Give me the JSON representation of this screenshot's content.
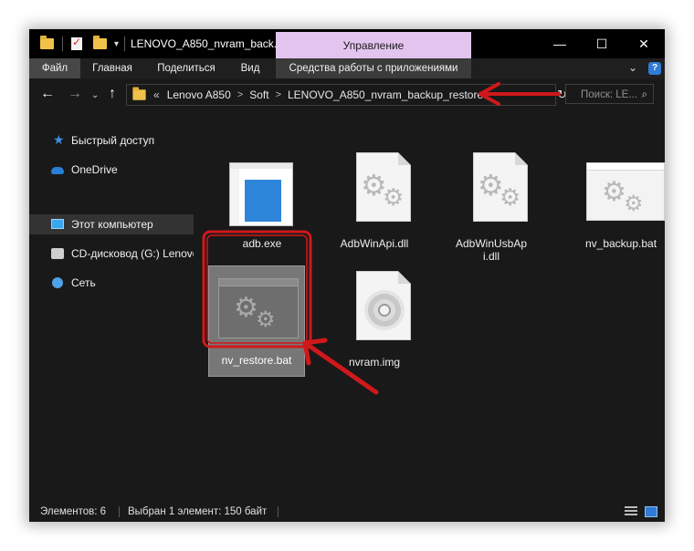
{
  "window": {
    "title": "LENOVO_A850_nvram_back...",
    "context_tab": "Управление",
    "controls": {
      "minimize": "—",
      "maximize": "☐",
      "close": "✕"
    }
  },
  "ribbon": {
    "tabs": [
      "Файл",
      "Главная",
      "Поделиться",
      "Вид",
      "Средства работы с приложениями"
    ],
    "help": "?",
    "collapse": "⌄"
  },
  "nav": {
    "back": "←",
    "forward": "→",
    "recent": "⌄",
    "up": "↑",
    "overflow": "«",
    "breadcrumb": [
      "Lenovo A850",
      "Soft",
      "LENOVO_A850_nvram_backup_restore"
    ],
    "crumb_separator": ">",
    "address_dropdown": "⌄",
    "refresh": "↻",
    "search_placeholder": "Поиск: LE...",
    "search_icon": "⌕"
  },
  "sidebar": {
    "items": [
      {
        "label": "Быстрый доступ",
        "icon": "star-icon",
        "glyph": "★"
      },
      {
        "label": "OneDrive",
        "icon": "cloud-icon",
        "glyph": ""
      },
      {
        "label": "Этот компьютер",
        "icon": "computer-icon",
        "glyph": "",
        "selected": true
      },
      {
        "label": "CD-дисковод (G:) Lenovo",
        "icon": "cd-drive-icon",
        "glyph": ""
      },
      {
        "label": "Сеть",
        "icon": "network-icon",
        "glyph": ""
      }
    ]
  },
  "files": [
    {
      "name": "adb.exe",
      "icon": "exe-icon"
    },
    {
      "name": "AdbWinApi.dll",
      "icon": "dll-gear-icon"
    },
    {
      "name": "AdbWinUsbApi.dll",
      "icon": "dll-gear-icon"
    },
    {
      "name": "nv_backup.bat",
      "icon": "bat-gear-icon"
    },
    {
      "name": "nv_restore.bat",
      "icon": "bat-gear-icon",
      "selected": true
    },
    {
      "name": "nvram.img",
      "icon": "disc-image-icon"
    }
  ],
  "status": {
    "count": "Элементов: 6",
    "selection": "Выбран 1 элемент: 150 байт"
  },
  "annotations": {
    "color": "#d0181b"
  }
}
